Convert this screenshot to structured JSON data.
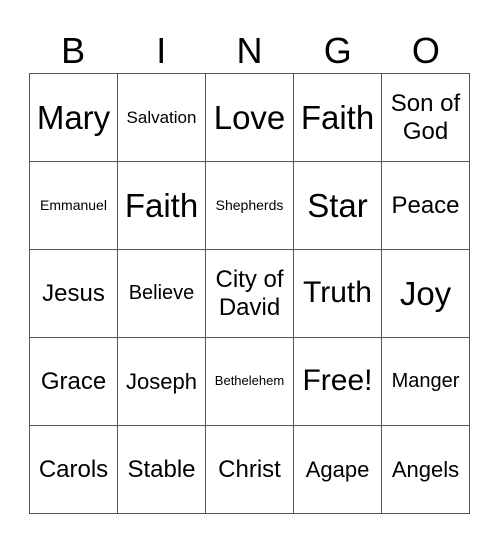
{
  "header": [
    "B",
    "I",
    "N",
    "G",
    "O"
  ],
  "rows": [
    [
      "Mary",
      "Salvation",
      "Love",
      "Faith",
      "Son of God"
    ],
    [
      "Emmanuel",
      "Faith",
      "Shepherds",
      "Star",
      "Peace"
    ],
    [
      "Jesus",
      "Believe",
      "City of David",
      "Truth",
      "Joy"
    ],
    [
      "Grace",
      "Joseph",
      "Bethelehem",
      "Free!",
      "Manger"
    ],
    [
      "Carols",
      "Stable",
      "Christ",
      "Agape",
      "Angels"
    ]
  ]
}
